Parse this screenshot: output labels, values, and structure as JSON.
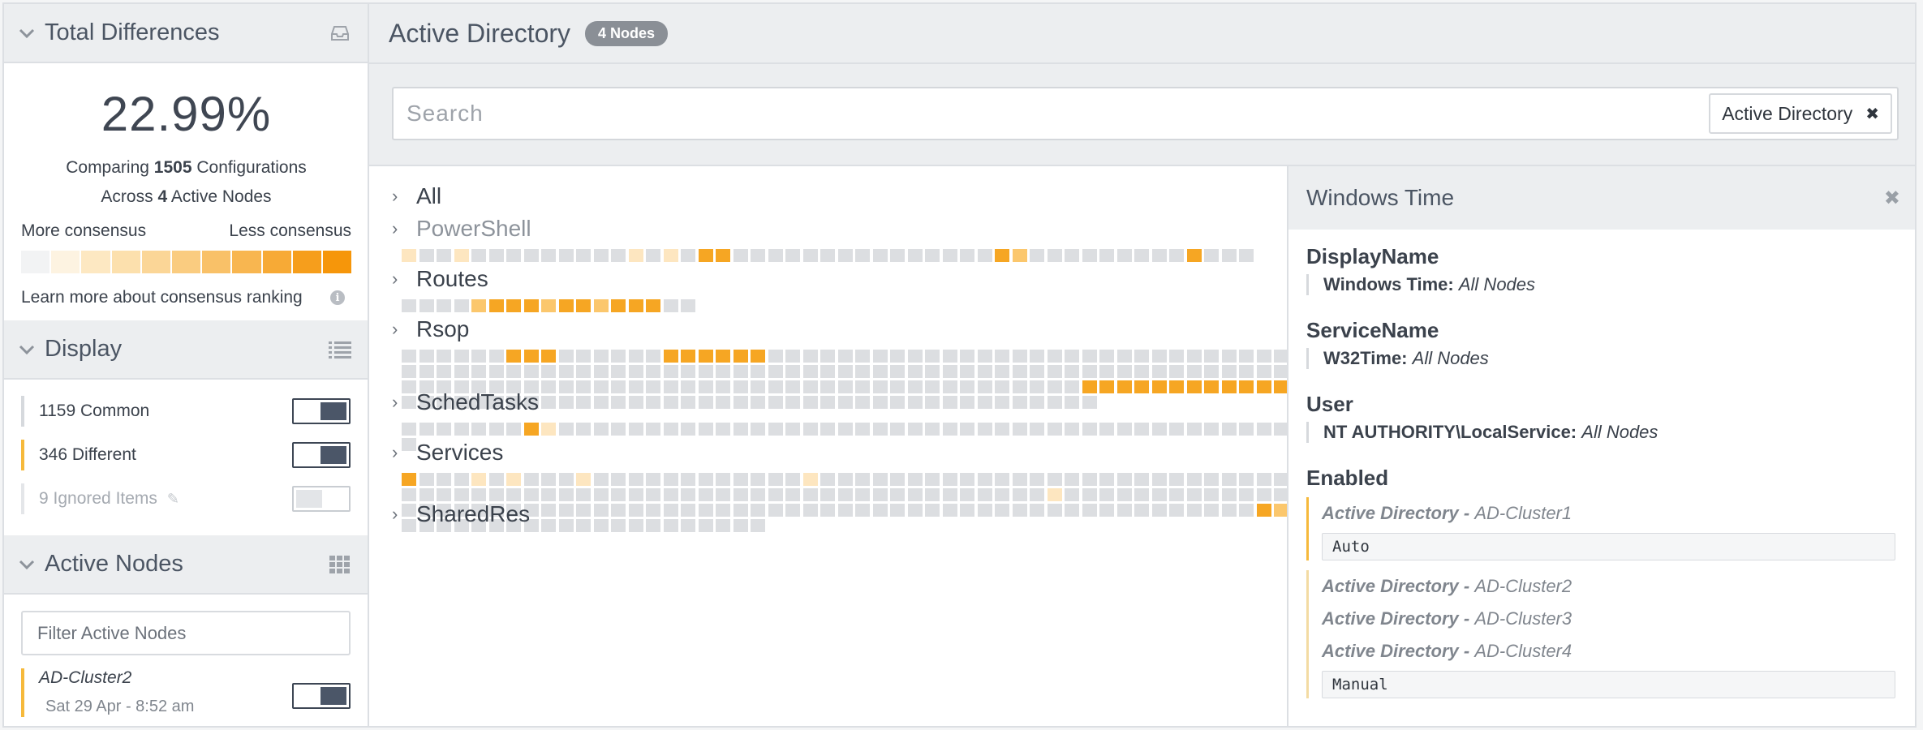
{
  "sidebar": {
    "total_differences": {
      "title": "Total Differences",
      "percent": "22.99%",
      "comparing_prefix": "Comparing",
      "configurations": "1505",
      "configurations_suffix": "Configurations",
      "across_prefix": "Across",
      "nodes": "4",
      "nodes_suffix": "Active Nodes",
      "more_consensus": "More consensus",
      "less_consensus": "Less consensus",
      "consensus_colors": [
        "#f2f3f4",
        "#fdf3e1",
        "#fde8c2",
        "#fce0ad",
        "#fbd697",
        "#facc80",
        "#f9c168",
        "#f8b650",
        "#f7aa36",
        "#f69e1c",
        "#f6960a"
      ],
      "learn_more": "Learn more about consensus ranking"
    },
    "display": {
      "title": "Display",
      "items": [
        {
          "label": "1159 Common",
          "on": true
        },
        {
          "label": "346 Different",
          "on": true
        },
        {
          "label": "9 Ignored Items",
          "on": false
        }
      ]
    },
    "active_nodes": {
      "title": "Active Nodes",
      "filter_placeholder": "Filter Active Nodes",
      "nodes": [
        {
          "name": "AD-Cluster2",
          "date": "Sat 29 Apr - 8:52 am",
          "on": true
        }
      ]
    }
  },
  "main": {
    "title": "Active Directory",
    "badge": "4 Nodes",
    "search_placeholder": "Search",
    "filter_tag": "Active Directory",
    "categories": [
      {
        "name": "All",
        "cells": [],
        "faded": false
      },
      {
        "name": "PowerShell",
        "faded": true,
        "cells": [
          "p",
          "g",
          "g",
          "p",
          "g",
          "g",
          "g",
          "g",
          "g",
          "g",
          "g",
          "g",
          "g",
          "p",
          "g",
          "p",
          "g",
          "o",
          "o",
          "g",
          "g",
          "g",
          "g",
          "g",
          "g",
          "g",
          "g",
          "g",
          "g",
          "g",
          "g",
          "g",
          "g",
          "g",
          "o",
          "l",
          "g",
          "g",
          "g",
          "g",
          "g",
          "g",
          "g",
          "g",
          "g",
          "o",
          "g",
          "g",
          "g"
        ]
      },
      {
        "name": "Routes",
        "faded": false,
        "cells": [
          "g",
          "g",
          "g",
          "g",
          "l",
          "o",
          "o",
          "o",
          "l",
          "o",
          "o",
          "l",
          "o",
          "o",
          "o",
          "g",
          "g"
        ]
      },
      {
        "name": "Rsop",
        "faded": false,
        "cells": [
          "g",
          "g",
          "g",
          "g",
          "g",
          "g",
          "o",
          "o",
          "o",
          "g",
          "g",
          "g",
          "g",
          "g",
          "g",
          "o",
          "o",
          "o",
          "o",
          "o",
          "o",
          "g",
          "g",
          "g",
          "g",
          "g",
          "g",
          "g",
          "g",
          "g",
          "g",
          "g",
          "g",
          "g",
          "g",
          "g",
          "g",
          "g",
          "g",
          "g",
          "g",
          "g",
          "g",
          "g",
          "g",
          "g",
          "g",
          "g",
          "g",
          "g",
          "g",
          "g",
          "g",
          "g",
          "g",
          "g",
          "g",
          "g",
          "g",
          "g",
          "g",
          "g",
          "g",
          "g",
          "g",
          "g",
          "g",
          "g",
          "g",
          "g",
          "g",
          "g",
          "g",
          "g",
          "g",
          "g",
          "g",
          "g",
          "g",
          "g",
          "g",
          "g",
          "g",
          "g",
          "g",
          "g",
          "g",
          "g",
          "g",
          "g",
          "g",
          "g",
          "g",
          "g",
          "g",
          "g",
          "g",
          "g",
          "g",
          "g",
          "g",
          "g",
          "g",
          "g",
          "g",
          "g",
          "g",
          "g",
          "g",
          "g",
          "g",
          "g",
          "g",
          "g",
          "g",
          "g",
          "g",
          "g",
          "g",
          "g",
          "g",
          "g",
          "g",
          "g",
          "g",
          "g",
          "g",
          "g",
          "g",
          "g",
          "g",
          "g",
          "g",
          "g",
          "g",
          "g",
          "g",
          "g",
          "g",
          "g",
          "g",
          "g",
          "g",
          "o",
          "o",
          "o",
          "o",
          "o",
          "o",
          "o",
          "o",
          "o",
          "o",
          "o",
          "o",
          "g",
          "g",
          "g",
          "g",
          "g",
          "g",
          "g",
          "g",
          "g",
          "g",
          "g",
          "g",
          "g",
          "g",
          "g",
          "g",
          "g",
          "g",
          "g",
          "g",
          "g",
          "g",
          "g",
          "g",
          "g",
          "g",
          "g",
          "g",
          "g",
          "g",
          "g",
          "g",
          "g",
          "g",
          "g",
          "g",
          "g",
          "g",
          "g",
          "g",
          "g"
        ]
      },
      {
        "name": "SchedTasks",
        "faded": false,
        "cells": [
          "g",
          "g",
          "g",
          "g",
          "g",
          "g",
          "g",
          "o",
          "p",
          "g",
          "g",
          "g",
          "g",
          "g",
          "g",
          "g",
          "g",
          "g",
          "g",
          "g",
          "g",
          "g",
          "g",
          "g",
          "g",
          "g",
          "g",
          "g",
          "g",
          "g",
          "g",
          "g",
          "g",
          "g",
          "g",
          "g",
          "g",
          "g",
          "g",
          "g",
          "g",
          "g",
          "g",
          "g",
          "g",
          "g",
          "g",
          "g",
          "g",
          "g",
          "g",
          "g",
          "g"
        ]
      },
      {
        "name": "Services",
        "faded": false,
        "cells": [
          "o",
          "g",
          "g",
          "g",
          "p",
          "g",
          "p",
          "g",
          "g",
          "g",
          "p",
          "g",
          "g",
          "g",
          "g",
          "g",
          "g",
          "g",
          "g",
          "g",
          "g",
          "g",
          "g",
          "p",
          "g",
          "g",
          "g",
          "g",
          "g",
          "g",
          "g",
          "g",
          "g",
          "g",
          "g",
          "g",
          "g",
          "g",
          "g",
          "g",
          "g",
          "g",
          "g",
          "g",
          "g",
          "g",
          "g",
          "g",
          "g",
          "g",
          "g",
          "g",
          "g",
          "g",
          "g",
          "g",
          "g",
          "g",
          "g",
          "g",
          "g",
          "g",
          "g",
          "g",
          "g",
          "g",
          "g",
          "g",
          "g",
          "g",
          "g",
          "g",
          "g",
          "g",
          "g",
          "g",
          "g",
          "g",
          "g",
          "g",
          "g",
          "g",
          "g",
          "g",
          "g",
          "g",
          "g",
          "g",
          "g",
          "p",
          "g",
          "g",
          "g",
          "g",
          "g",
          "g",
          "g",
          "g",
          "g",
          "g",
          "g",
          "g",
          "g",
          "g",
          "g",
          "g",
          "g",
          "g",
          "g",
          "g",
          "g",
          "g",
          "g",
          "g",
          "g",
          "g",
          "g",
          "g",
          "g",
          "g",
          "g",
          "g",
          "g",
          "g",
          "g",
          "g",
          "g",
          "g",
          "g",
          "g",
          "g",
          "g",
          "g",
          "g",
          "g",
          "g",
          "g",
          "g",
          "g",
          "g",
          "g",
          "g",
          "g",
          "g",
          "g",
          "g",
          "g",
          "g",
          "g",
          "g",
          "g",
          "g",
          "g",
          "o",
          "l",
          "g",
          "g",
          "g",
          "g",
          "g",
          "g",
          "g",
          "g",
          "g",
          "g",
          "g",
          "g",
          "g",
          "g",
          "g",
          "g",
          "g",
          "g",
          "g",
          "g",
          "g",
          "g"
        ]
      },
      {
        "name": "SharedRes",
        "faded": false,
        "cells": []
      }
    ],
    "cell_colors": {
      "g": "#dcdee1",
      "p": "#fde6c0",
      "l": "#fbc76d",
      "o": "#f6a623"
    }
  },
  "detail": {
    "title": "Windows Time",
    "fields": [
      {
        "name": "DisplayName",
        "value": "Windows Time:",
        "scope": "All Nodes"
      },
      {
        "name": "ServiceName",
        "value": "W32Time:",
        "scope": "All Nodes"
      },
      {
        "name": "User",
        "value": "NT AUTHORITY\\LocalService:",
        "scope": "All Nodes"
      }
    ],
    "enabled": {
      "name": "Enabled",
      "group1": [
        {
          "env": "Active Directory",
          "sep": " - ",
          "node": "AD-Cluster1"
        }
      ],
      "group1_value": "Auto",
      "group2": [
        {
          "env": "Active Directory",
          "sep": " - ",
          "node": "AD-Cluster2"
        },
        {
          "env": "Active Directory",
          "sep": " - ",
          "node": "AD-Cluster3"
        },
        {
          "env": "Active Directory",
          "sep": " - ",
          "node": "AD-Cluster4"
        }
      ],
      "group2_value": "Manual"
    }
  }
}
